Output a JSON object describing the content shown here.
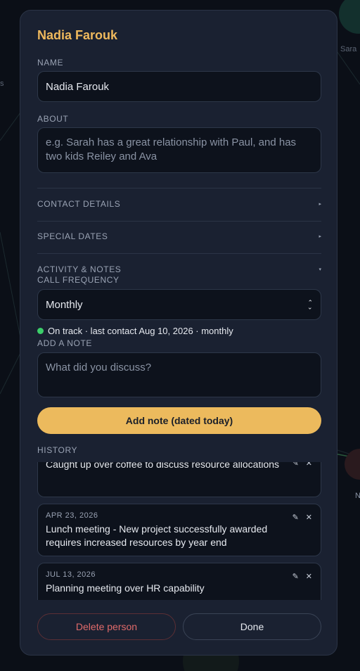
{
  "background": {
    "node_labels": [
      "Sara",
      "s",
      "N"
    ]
  },
  "panel": {
    "title": "Nadia Farouk",
    "name": {
      "label": "NAME",
      "value": "Nadia Farouk"
    },
    "about": {
      "label": "ABOUT",
      "placeholder": "e.g. Sarah has a great relationship with Paul, and has two kids Reiley and Ava"
    },
    "sections": [
      {
        "label": "CONTACT DETAILS",
        "caret": "▸"
      },
      {
        "label": "SPECIAL DATES",
        "caret": "▸"
      },
      {
        "label": "ACTIVITY & NOTES",
        "caret": "▾"
      }
    ],
    "call_frequency": {
      "label": "CALL FREQUENCY",
      "value": "Monthly"
    },
    "status": {
      "text": "On track · last contact Aug 10, 2026 · monthly",
      "color": "#3ccf6a"
    },
    "add_note": {
      "label": "ADD A NOTE",
      "placeholder": "What did you discuss?",
      "button": "Add note (dated today)"
    },
    "history": {
      "label": "HISTORY",
      "items": [
        {
          "date": "",
          "text": "Caught up over coffee to discuss resource allocations"
        },
        {
          "date": "APR 23, 2026",
          "text": "Lunch meeting - New project successfully awarded requires increased resources by year end"
        },
        {
          "date": "JUL 13, 2026",
          "text": "Planning meeting over HR capability"
        }
      ],
      "edit_icon": "✎",
      "delete_icon": "✕"
    },
    "footer": {
      "delete": "Delete person",
      "done": "Done"
    }
  },
  "colors": {
    "accent": "#ecba5d",
    "title": "#efb95d",
    "danger": "#e06a6a",
    "panel": "#1a2131",
    "field": "#0d121c",
    "status_ok": "#3ccf6a"
  }
}
